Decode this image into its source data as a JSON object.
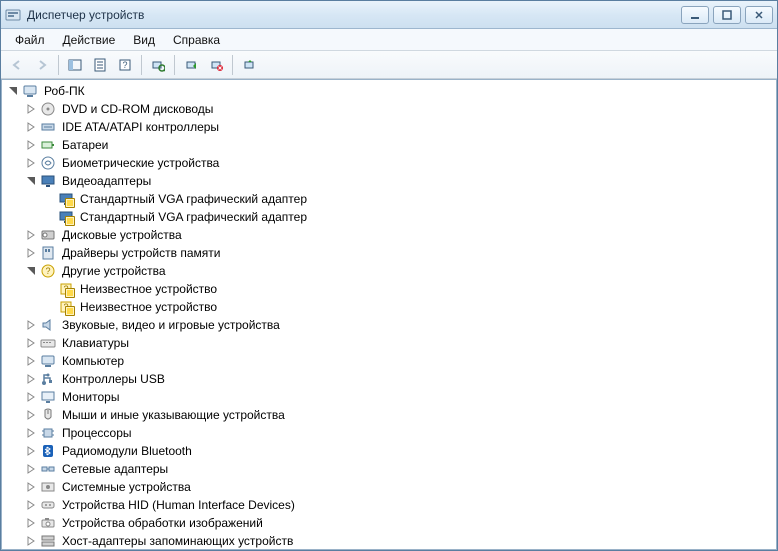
{
  "window": {
    "title": "Диспетчер устройств"
  },
  "menu": {
    "file": "Файл",
    "action": "Действие",
    "view": "Вид",
    "help": "Справка"
  },
  "tree": {
    "root": "Роб-ПК",
    "categories": [
      {
        "label": "DVD и CD-ROM дисководы",
        "icon": "disc"
      },
      {
        "label": "IDE ATA/ATAPI контроллеры",
        "icon": "ide"
      },
      {
        "label": "Батареи",
        "icon": "battery"
      },
      {
        "label": "Биометрические устройства",
        "icon": "biometric"
      },
      {
        "label": "Видеоадаптеры",
        "icon": "display",
        "expanded": true,
        "children": [
          {
            "label": "Стандартный VGA графический адаптер",
            "warn": true
          },
          {
            "label": "Стандартный VGA графический адаптер",
            "warn": true
          }
        ]
      },
      {
        "label": "Дисковые устройства",
        "icon": "hdd"
      },
      {
        "label": "Драйверы устройств памяти",
        "icon": "memcard"
      },
      {
        "label": "Другие устройства",
        "icon": "other",
        "expanded": true,
        "children": [
          {
            "label": "Неизвестное устройство",
            "warn": true
          },
          {
            "label": "Неизвестное устройство",
            "warn": true
          }
        ]
      },
      {
        "label": "Звуковые, видео и игровые устройства",
        "icon": "audio"
      },
      {
        "label": "Клавиатуры",
        "icon": "keyboard"
      },
      {
        "label": "Компьютер",
        "icon": "computer"
      },
      {
        "label": "Контроллеры USB",
        "icon": "usb"
      },
      {
        "label": "Мониторы",
        "icon": "monitor"
      },
      {
        "label": "Мыши и иные указывающие устройства",
        "icon": "mouse"
      },
      {
        "label": "Процессоры",
        "icon": "cpu"
      },
      {
        "label": "Радиомодули Bluetooth",
        "icon": "bluetooth"
      },
      {
        "label": "Сетевые адаптеры",
        "icon": "network"
      },
      {
        "label": "Системные устройства",
        "icon": "system"
      },
      {
        "label": "Устройства HID (Human Interface Devices)",
        "icon": "hid"
      },
      {
        "label": "Устройства обработки изображений",
        "icon": "imaging"
      },
      {
        "label": "Хост-адаптеры запоминающих устройств",
        "icon": "storagehost"
      }
    ]
  }
}
